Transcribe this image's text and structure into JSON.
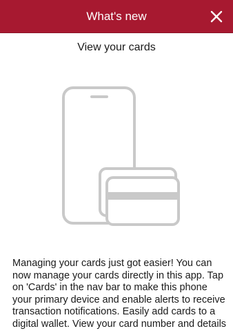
{
  "header": {
    "title": "What's new",
    "close_icon": "close-icon",
    "background_color": "#a71930"
  },
  "content": {
    "subtitle": "View your cards",
    "illustration_icon": "phone-with-card-icon",
    "description": "Managing your cards just got easier! You can now manage your cards directly in this app. Tap on 'Cards' in the nav bar to make this phone your primary device and enable alerts to receive transaction notifications. Easily add cards to a digital wallet. View your card number and details"
  }
}
